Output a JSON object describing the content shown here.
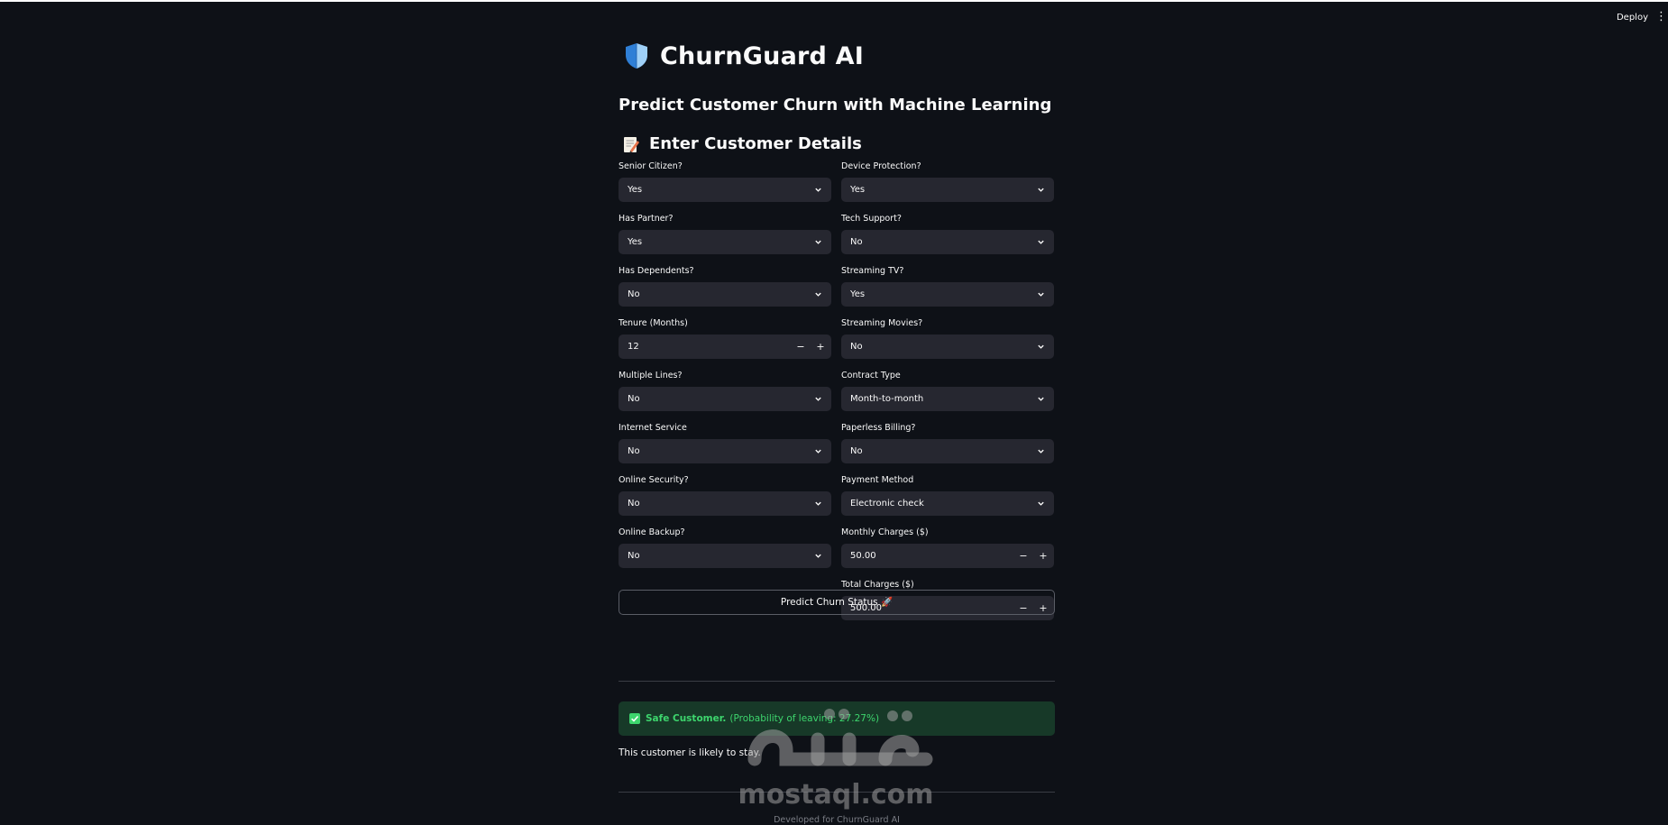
{
  "topbar": {
    "deploy_label": "Deploy",
    "menu_icon": "vertical-dots-icon"
  },
  "header": {
    "icon": "shield-icon",
    "title": "ChurnGuard AI",
    "subtitle": "Predict Customer Churn with Machine Learning",
    "section_icon": "memo-icon",
    "section_title": "Enter Customer Details"
  },
  "form": {
    "left": [
      {
        "label": "Senior Citizen?",
        "type": "select",
        "value": "Yes"
      },
      {
        "label": "Has Partner?",
        "type": "select",
        "value": "Yes"
      },
      {
        "label": "Has Dependents?",
        "type": "select",
        "value": "No"
      },
      {
        "label": "Tenure (Months)",
        "type": "number",
        "value": "12"
      },
      {
        "label": "Multiple Lines?",
        "type": "select",
        "value": "No"
      },
      {
        "label": "Internet Service",
        "type": "select",
        "value": "No"
      },
      {
        "label": "Online Security?",
        "type": "select",
        "value": "No"
      },
      {
        "label": "Online Backup?",
        "type": "select",
        "value": "No"
      }
    ],
    "right": [
      {
        "label": "Device Protection?",
        "type": "select",
        "value": "Yes"
      },
      {
        "label": "Tech Support?",
        "type": "select",
        "value": "No"
      },
      {
        "label": "Streaming TV?",
        "type": "select",
        "value": "Yes"
      },
      {
        "label": "Streaming Movies?",
        "type": "select",
        "value": "No"
      },
      {
        "label": "Contract Type",
        "type": "select",
        "value": "Month-to-month"
      },
      {
        "label": "Paperless Billing?",
        "type": "select",
        "value": "No"
      },
      {
        "label": "Payment Method",
        "type": "select",
        "value": "Electronic check"
      },
      {
        "label": "Monthly Charges ($)",
        "type": "number",
        "value": "50.00"
      },
      {
        "label": "Total Charges ($)",
        "type": "number",
        "value": "500.00"
      }
    ],
    "stepper_minus": "−",
    "stepper_plus": "+"
  },
  "predict_button": {
    "label": "Predict Churn Status 🚀"
  },
  "result": {
    "icon": "check-box-icon",
    "bold_text": "Safe Customer.",
    "detail_text": "(Probability of leaving: 27.27%)",
    "message": "This customer is likely to stay."
  },
  "footer": {
    "text": "Developed for ChurnGuard AI"
  },
  "watermark": {
    "text": "mostaql.com"
  },
  "colors": {
    "background": "#0e1117",
    "input_bg": "#262730",
    "success_bg": "#173928",
    "success_text": "#3dd56d"
  }
}
